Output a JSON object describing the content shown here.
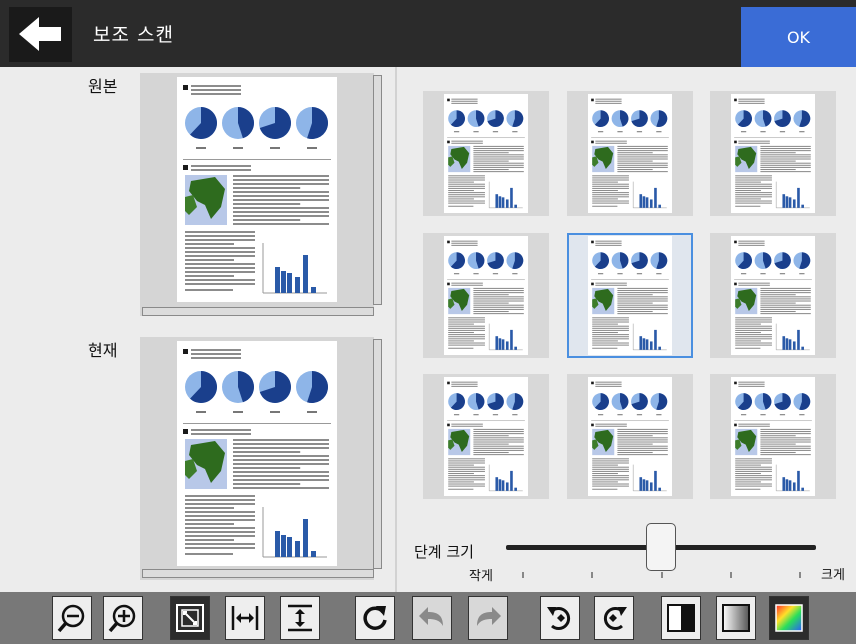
{
  "header": {
    "title": "보조 스캔",
    "ok_label": "OK",
    "back_icon": "arrow-left-icon"
  },
  "preview": {
    "original_label": "원본",
    "current_label": "현재"
  },
  "grid": {
    "rows": 3,
    "cols": 3,
    "selected_index": 4
  },
  "slider": {
    "label": "단계 크기",
    "min_label": "작게",
    "max_label": "크게",
    "value_fraction": 0.5,
    "tick_count": 5
  },
  "toolbar": {
    "icons": [
      "zoom-out-icon",
      "zoom-in-icon",
      "fit-page-icon",
      "fit-width-icon",
      "fit-height-icon",
      "rotate-icon",
      "undo-icon",
      "redo-icon",
      "rotate-left-icon",
      "rotate-right-icon",
      "mono-mode-icon",
      "gray-mode-icon",
      "color-mode-icon"
    ]
  },
  "colors": {
    "accent": "#3a6cd6",
    "header_bg": "#2b2b2b",
    "selection": "#4a8fe0",
    "pie_dark": "#1a3f8c",
    "pie_light": "#8eb5e8"
  }
}
